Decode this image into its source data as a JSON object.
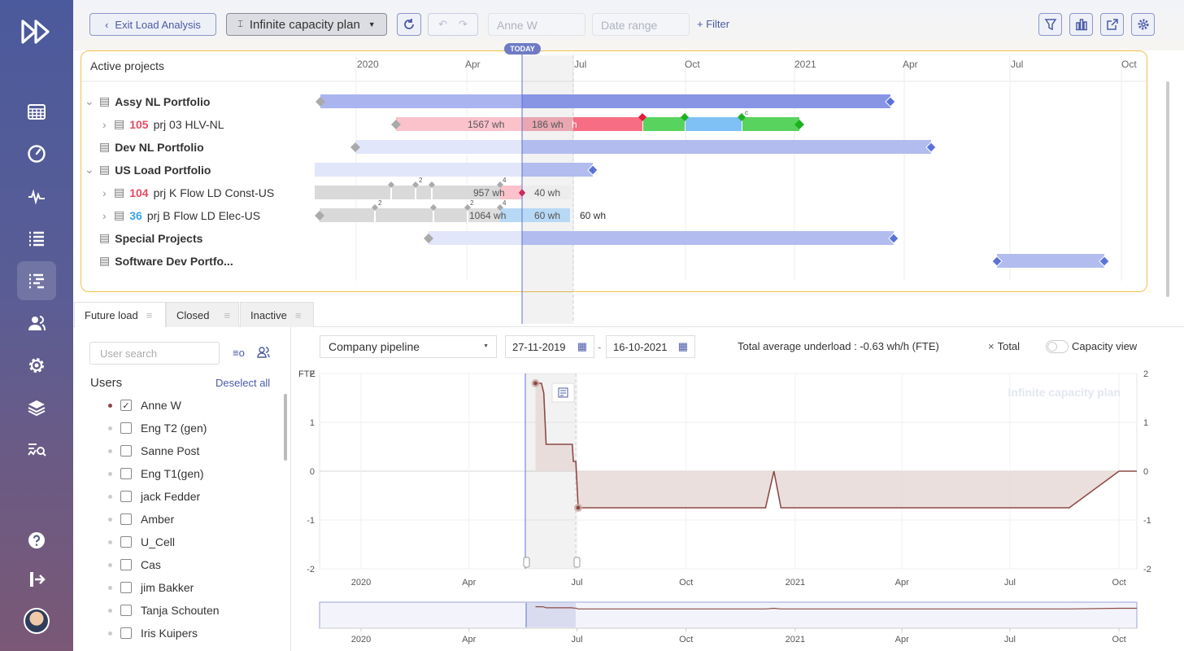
{
  "toolbar": {
    "exit_label": "Exit Load Analysis",
    "plan_label": "Infinite capacity plan",
    "user_field_placeholder": "Anne W",
    "date_range_placeholder": "Date range",
    "filter_label": "+ Filter"
  },
  "gantt": {
    "title": "Active projects",
    "today_badge": "TODAY",
    "axis_labels": [
      "2020",
      "Apr",
      "Jul",
      "Oct",
      "2021",
      "Apr",
      "Jul",
      "Oct"
    ],
    "rows": [
      {
        "label": "Assy NL Portfolio",
        "bold": true
      },
      {
        "number": "105",
        "label": "prj 03 HLV-NL",
        "wh_left": "1567 wh",
        "wh_right": "186 wh",
        "wh_tail": "h"
      },
      {
        "label": "Dev NL Portfolio",
        "bold": true
      },
      {
        "label": "US Load Portfolio",
        "bold": true
      },
      {
        "number": "104",
        "label": "prj K Flow LD Const-US",
        "wh_left": "957 wh",
        "wh_right": "40 wh"
      },
      {
        "number": "36",
        "label": "prj B Flow LD Elec-US",
        "wh_left": "1064 wh",
        "wh_right": "60 wh",
        "wh_after": "60 wh"
      },
      {
        "label": "Special Projects",
        "bold": true
      },
      {
        "label": "Software Dev Portfo...",
        "bold": true
      }
    ],
    "milestone_counts": {
      "r1": "c",
      "r4a": "2",
      "r4b": "4",
      "r5a": "2",
      "r5b": "2",
      "r5c": "4"
    }
  },
  "tabs": [
    {
      "label": "Future load",
      "active": true
    },
    {
      "label": "Closed",
      "active": false
    },
    {
      "label": "Inactive",
      "active": false
    }
  ],
  "users_panel": {
    "search_placeholder": "User search",
    "heading": "Users",
    "deselect_label": "Deselect all",
    "users": [
      {
        "name": "Anne W",
        "checked": true
      },
      {
        "name": "Eng T2 (gen)",
        "checked": false
      },
      {
        "name": "Sanne Post",
        "checked": false
      },
      {
        "name": "Eng T1(gen)",
        "checked": false
      },
      {
        "name": "jack Fedder",
        "checked": false
      },
      {
        "name": "Amber",
        "checked": false
      },
      {
        "name": "U_Cell",
        "checked": false
      },
      {
        "name": "Cas",
        "checked": false
      },
      {
        "name": "jim Bakker",
        "checked": false
      },
      {
        "name": "Tanja Schouten",
        "checked": false
      },
      {
        "name": "Iris Kuipers",
        "checked": false
      }
    ]
  },
  "chart_controls": {
    "pipeline": "Company pipeline",
    "date_from": "27-11-2019",
    "date_to": "16-10-2021",
    "summary": "Total average underload : -0.63 wh/h (FTE)",
    "total_label": "Total",
    "capacity_view_label": "Capacity view"
  },
  "colors": {
    "accent": "#4a5aa6",
    "line": "#8b4a46",
    "fill": "#e6d9d6",
    "milestone": "#5a72d8",
    "highlight": "#f0c24a"
  },
  "chart_data": {
    "type": "area",
    "watermark": "Infinite capacity plan",
    "ylabel": "FTE",
    "ylim": [
      -2,
      2
    ],
    "yticks": [
      -2,
      -1,
      0,
      1,
      2
    ],
    "x_tick_labels": [
      "2020",
      "Apr",
      "Jul",
      "Oct",
      "2021",
      "Apr",
      "Jul",
      "Oct"
    ],
    "today": "2020-05-27",
    "series": [
      {
        "values": [
          {
            "x": "2020-05-27",
            "y": 1.8
          },
          {
            "x": "2020-06-01",
            "y": 1.8
          },
          {
            "x": "2020-06-03",
            "y": 1.6
          },
          {
            "x": "2020-06-05",
            "y": 0.55
          },
          {
            "x": "2020-06-27",
            "y": 0.55
          },
          {
            "x": "2020-06-28",
            "y": 0.2
          },
          {
            "x": "2020-06-30",
            "y": 0.2
          },
          {
            "x": "2020-07-02",
            "y": -0.75
          },
          {
            "x": "2020-12-07",
            "y": -0.75
          },
          {
            "x": "2020-12-14",
            "y": 0.0
          },
          {
            "x": "2020-12-20",
            "y": -0.75
          },
          {
            "x": "2021-08-20",
            "y": -0.75
          },
          {
            "x": "2021-10-01",
            "y": 0.0
          },
          {
            "x": "2021-10-16",
            "y": 0.0
          }
        ]
      }
    ],
    "navigator": true
  }
}
